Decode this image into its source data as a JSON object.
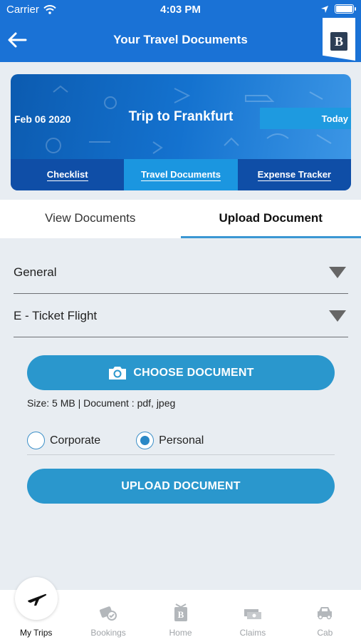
{
  "status": {
    "carrier": "Carrier",
    "time": "4:03 PM"
  },
  "header": {
    "title": "Your Travel Documents",
    "brand_letter": "B"
  },
  "trip": {
    "date": "Feb 06 2020",
    "name": "Trip to Frankfurt",
    "badge": "Today",
    "tabs": [
      {
        "label": "Checklist",
        "active": false
      },
      {
        "label": "Travel Documents",
        "active": true
      },
      {
        "label": "Expense Tracker",
        "active": false
      }
    ]
  },
  "doc_tabs": [
    {
      "label": "View Documents",
      "active": false
    },
    {
      "label": "Upload Document",
      "active": true
    }
  ],
  "form": {
    "category": "General",
    "doc_type": "E - Ticket Flight",
    "choose_label": "CHOOSE DOCUMENT",
    "size_note": "Size: 5 MB | Document : pdf, jpeg",
    "radio_corporate": "Corporate",
    "radio_personal": "Personal",
    "selected": "Personal",
    "upload_label": "UPLOAD DOCUMENT"
  },
  "nav": [
    {
      "label": "My Trips",
      "icon": "plane-icon",
      "active": true
    },
    {
      "label": "Bookings",
      "icon": "tickets-icon",
      "active": false
    },
    {
      "label": "Home",
      "icon": "brand-home-icon",
      "active": false
    },
    {
      "label": "Claims",
      "icon": "money-icon",
      "active": false
    },
    {
      "label": "Cab",
      "icon": "car-icon",
      "active": false
    }
  ],
  "colors": {
    "header": "#1a72d6",
    "button": "#2a97cd",
    "tab_underline": "#3b97d3"
  }
}
